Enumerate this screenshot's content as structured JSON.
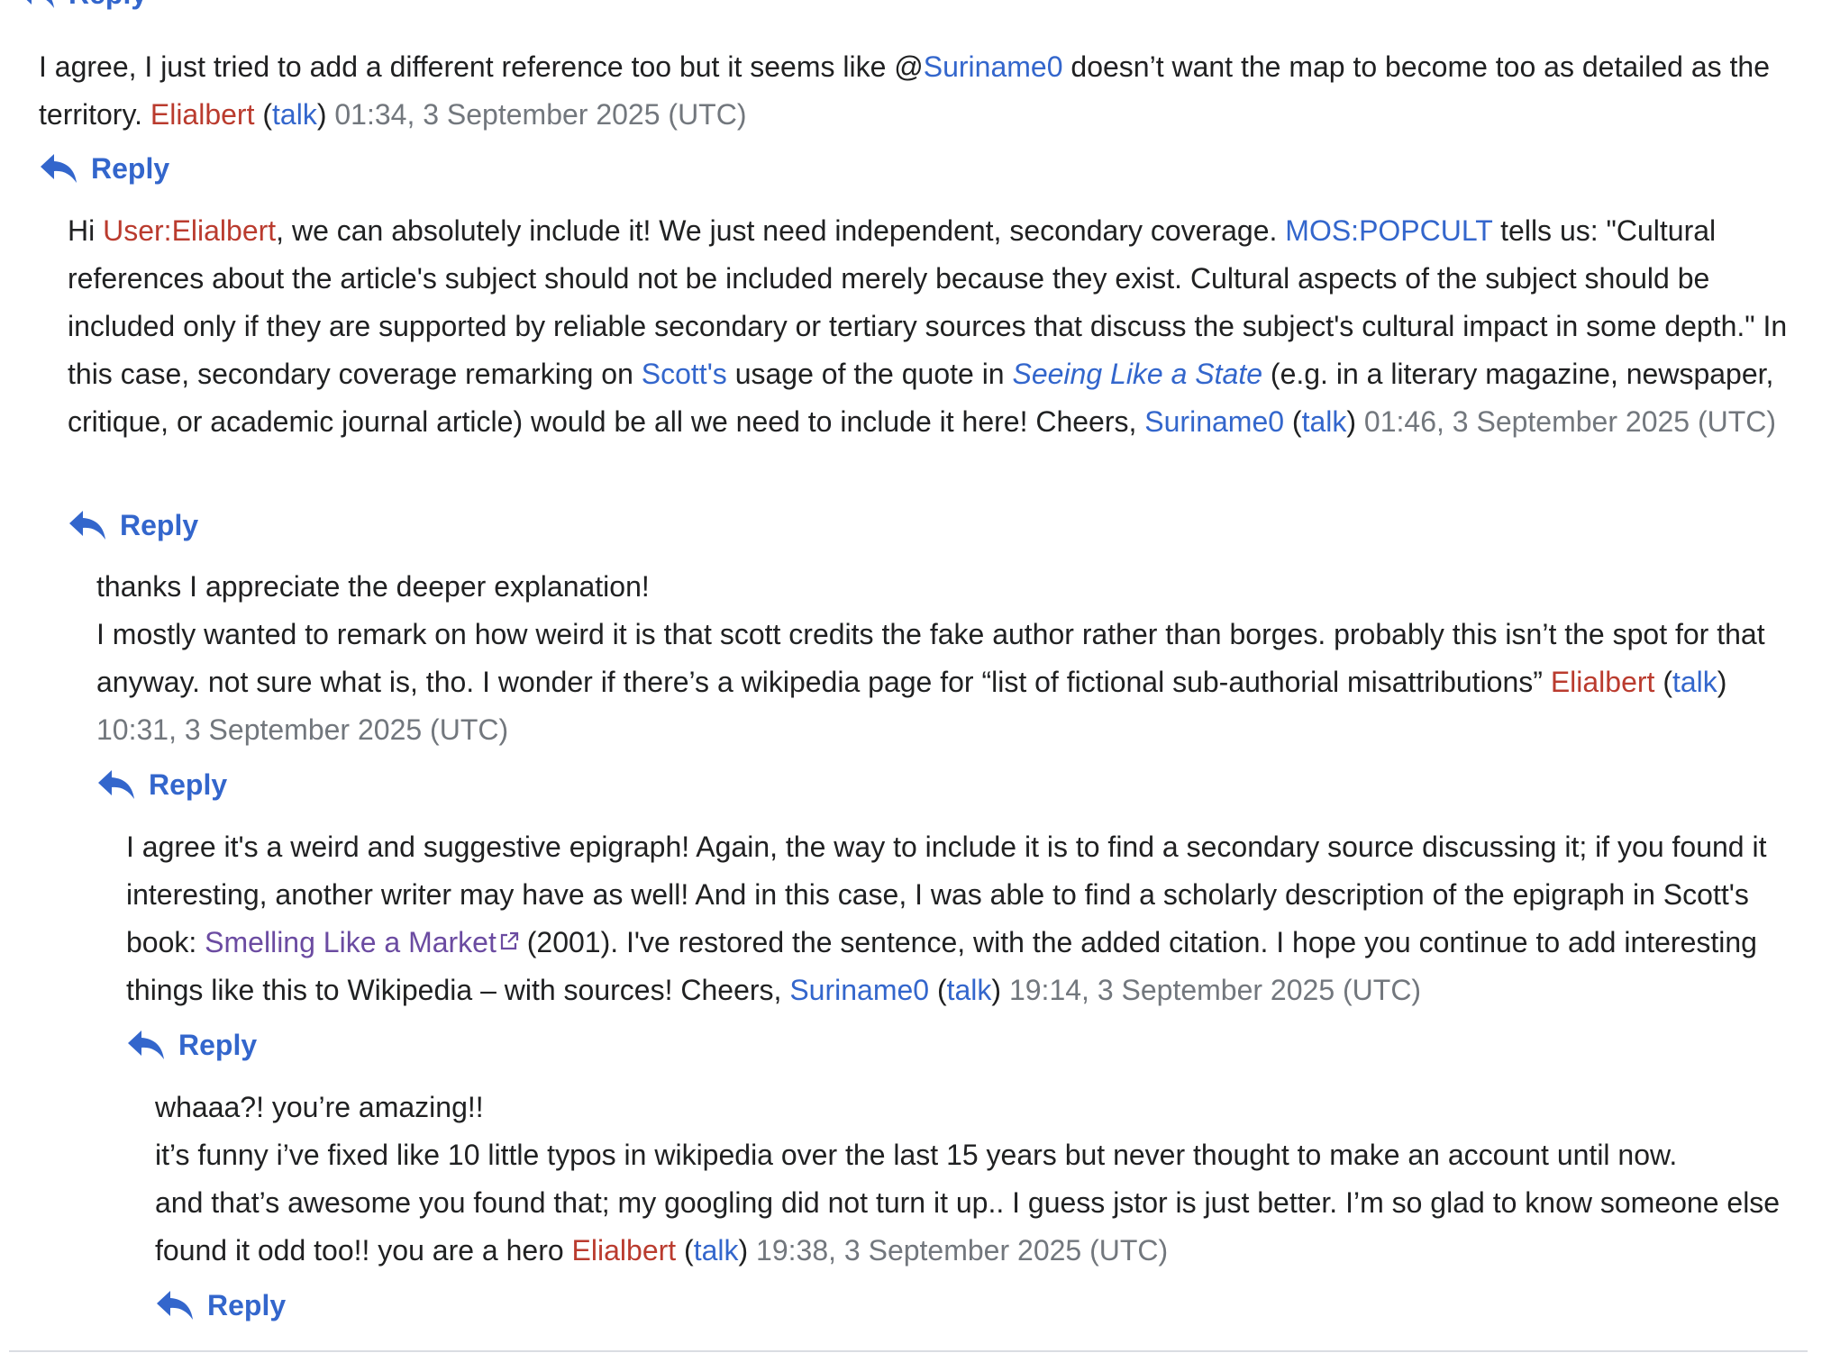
{
  "reply_label": "Reply",
  "c1": {
    "t1": "I agree, I just tried to add a different reference too but it seems like @",
    "mention": "Suriname0",
    "t2": " doesn’t want the map to become too as detailed as the territory. ",
    "user": "Elialbert",
    "talk": "talk",
    "ts": "01:34, 3 September 2025 (UTC)"
  },
  "c2": {
    "t1": "Hi ",
    "user_link": "User:Elialbert",
    "t2": ", we can absolutely include it! We just need independent, secondary coverage. ",
    "mos": "MOS:POPCULT",
    "t3": " tells us: \"Cultural references about the article's subject should not be included merely because they exist. Cultural aspects of the subject should be included only if they are supported by reliable secondary or tertiary sources that discuss the subject's cultural impact in some depth.\" In this case, secondary coverage remarking on ",
    "scott": "Scott's",
    "t4": " usage of the quote in ",
    "book": "Seeing Like a State",
    "t5": " (e.g. in a literary magazine, newspaper, critique, or academic journal article) would be all we need to include it here! Cheers, ",
    "user": "Suriname0",
    "talk": "talk",
    "ts": "01:46, 3 September 2025 (UTC)"
  },
  "c3": {
    "line1": "thanks I appreciate the deeper explanation!",
    "t1": "I mostly wanted to remark on how weird it is that scott credits the fake author rather than borges. probably this isn’t the spot for that anyway. not sure what is, tho. I wonder if there’s a wikipedia page for “list of fictional sub-authorial misattributions” ",
    "user": "Elialbert",
    "talk": "talk",
    "ts": "10:31, 3 September 2025 (UTC)"
  },
  "c4": {
    "t1": "I agree it's a weird and suggestive epigraph! Again, the way to include it is to find a secondary source discussing it; if you found it interesting, another writer may have as well! And in this case, I was able to find a scholarly description of the epigraph in Scott's book: ",
    "ext_link": "Smelling Like a Market",
    "t2": " (2001). I've restored the sentence, with the added citation. I hope you continue to add interesting things like this to Wikipedia – with sources! Cheers, ",
    "user": "Suriname0",
    "talk": "talk",
    "ts": "19:14, 3 September 2025 (UTC)"
  },
  "c5": {
    "line1": "whaaa?! you’re amazing!!",
    "line2": "it’s funny i’ve fixed like 10 little typos in wikipedia over the last 15 years but never thought to make an account until now.",
    "t1": "and that’s awesome you found that; my googling did not turn it up.. I guess jstor is just better. I’m so glad to know someone else found it odd too!! you are a hero ",
    "user": "Elialbert",
    "talk": "talk",
    "ts": "19:38, 3 September 2025 (UTC)"
  }
}
